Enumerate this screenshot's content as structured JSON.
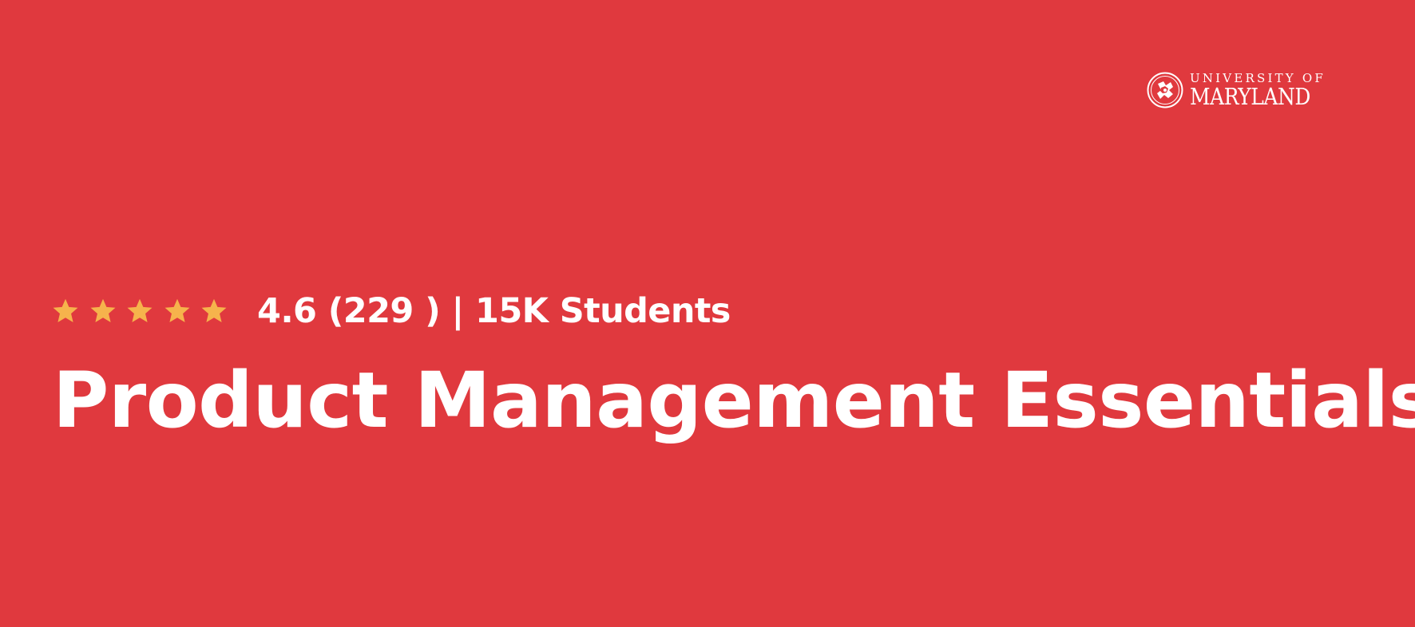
{
  "banner": {
    "background_color": "#e0393e",
    "star_color": "#f6b34c",
    "text_color": "#ffffff"
  },
  "logo": {
    "icon": "university-seal-icon",
    "line1": "UNIVERSITY OF",
    "line2": "MARYLAND"
  },
  "rating": {
    "stars_filled": 5,
    "stars_total": 5,
    "icon": "star-icon",
    "text": "4.6 (229 ) | 15K Students"
  },
  "course": {
    "title": "Product Management Essentials"
  }
}
